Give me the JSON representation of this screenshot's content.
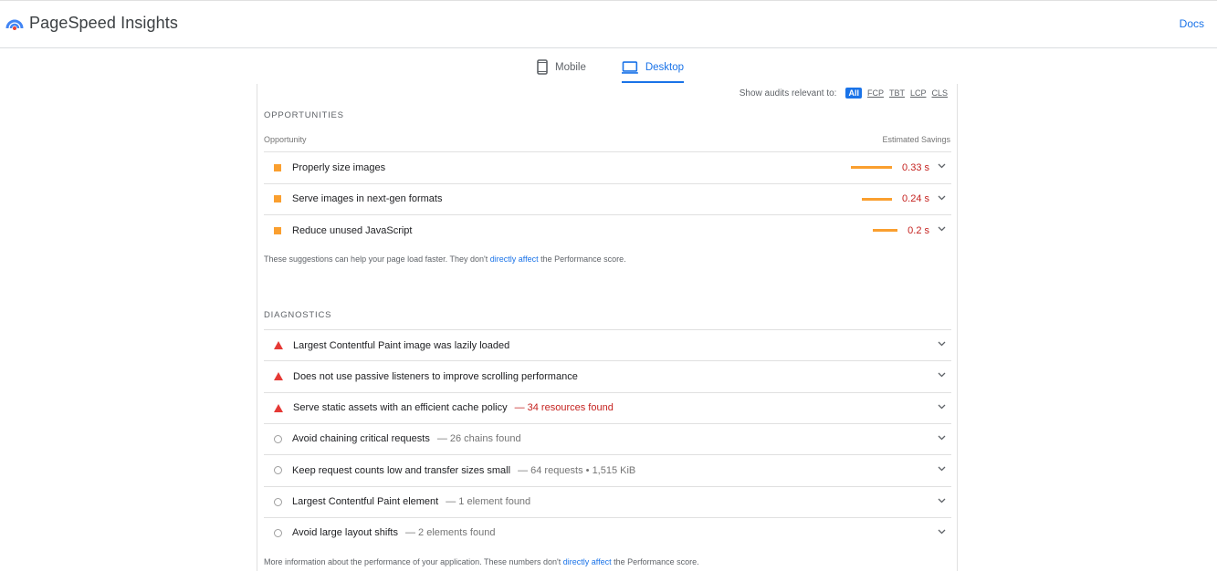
{
  "header": {
    "brand": "PageSpeed Insights",
    "docs_label": "Docs",
    "colors": {
      "accent": "#1a73e8",
      "logo_blue": "#4285f4",
      "logo_red": "#ea4335"
    }
  },
  "tabs": [
    {
      "label": "Mobile",
      "icon": "smartphone-icon",
      "active": false
    },
    {
      "label": "Desktop",
      "icon": "laptop-icon",
      "active": true
    }
  ],
  "filter": {
    "label": "Show audits relevant to:",
    "options": [
      "All",
      "FCP",
      "TBT",
      "LCP",
      "CLS"
    ],
    "selected": "All"
  },
  "opportunities": {
    "title": "OPPORTUNITIES",
    "col_left": "Opportunity",
    "col_right": "Estimated Savings",
    "items": [
      {
        "title": "Properly size images",
        "savings": "0.33 s",
        "savings_seconds": 0.33
      },
      {
        "title": "Serve images in next-gen formats",
        "savings": "0.24 s",
        "savings_seconds": 0.24
      },
      {
        "title": "Reduce unused JavaScript",
        "savings": "0.2 s",
        "savings_seconds": 0.2
      }
    ],
    "note_pre": "These suggestions can help your page load faster. They don't ",
    "note_link": "directly affect",
    "note_post": " the Performance score."
  },
  "diagnostics": {
    "title": "DIAGNOSTICS",
    "items": [
      {
        "status": "fail",
        "title": "Largest Contentful Paint image was lazily loaded",
        "detail": ""
      },
      {
        "status": "fail",
        "title": "Does not use passive listeners to improve scrolling performance",
        "detail": ""
      },
      {
        "status": "fail",
        "title": "Serve static assets with an efficient cache policy",
        "detail": "— 34 resources found"
      },
      {
        "status": "info",
        "title": "Avoid chaining critical requests",
        "detail": "— 26 chains found"
      },
      {
        "status": "info",
        "title": "Keep request counts low and transfer sizes small",
        "detail": "— 64 requests • 1,515 KiB"
      },
      {
        "status": "info",
        "title": "Largest Contentful Paint element",
        "detail": "— 1 element found"
      },
      {
        "status": "info",
        "title": "Avoid large layout shifts",
        "detail": "— 2 elements found"
      }
    ],
    "note_pre": "More information about the performance of your application. These numbers don't ",
    "note_link": "directly affect",
    "note_post": " the Performance score."
  }
}
